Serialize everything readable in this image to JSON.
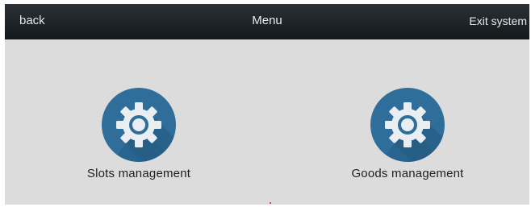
{
  "header": {
    "back_label": "back",
    "title": "Menu",
    "exit_label": "Exit system"
  },
  "tiles": [
    {
      "label": "Slots management",
      "icon": "gear-icon"
    },
    {
      "label": "Goods management",
      "icon": "gear-icon"
    }
  ],
  "colors": {
    "header_bg": "#1b2024",
    "content_bg": "#dcdcdc",
    "icon_circle": "#2f6e9a",
    "icon_shadow": "#245a80",
    "gear": "#e9eef2"
  }
}
